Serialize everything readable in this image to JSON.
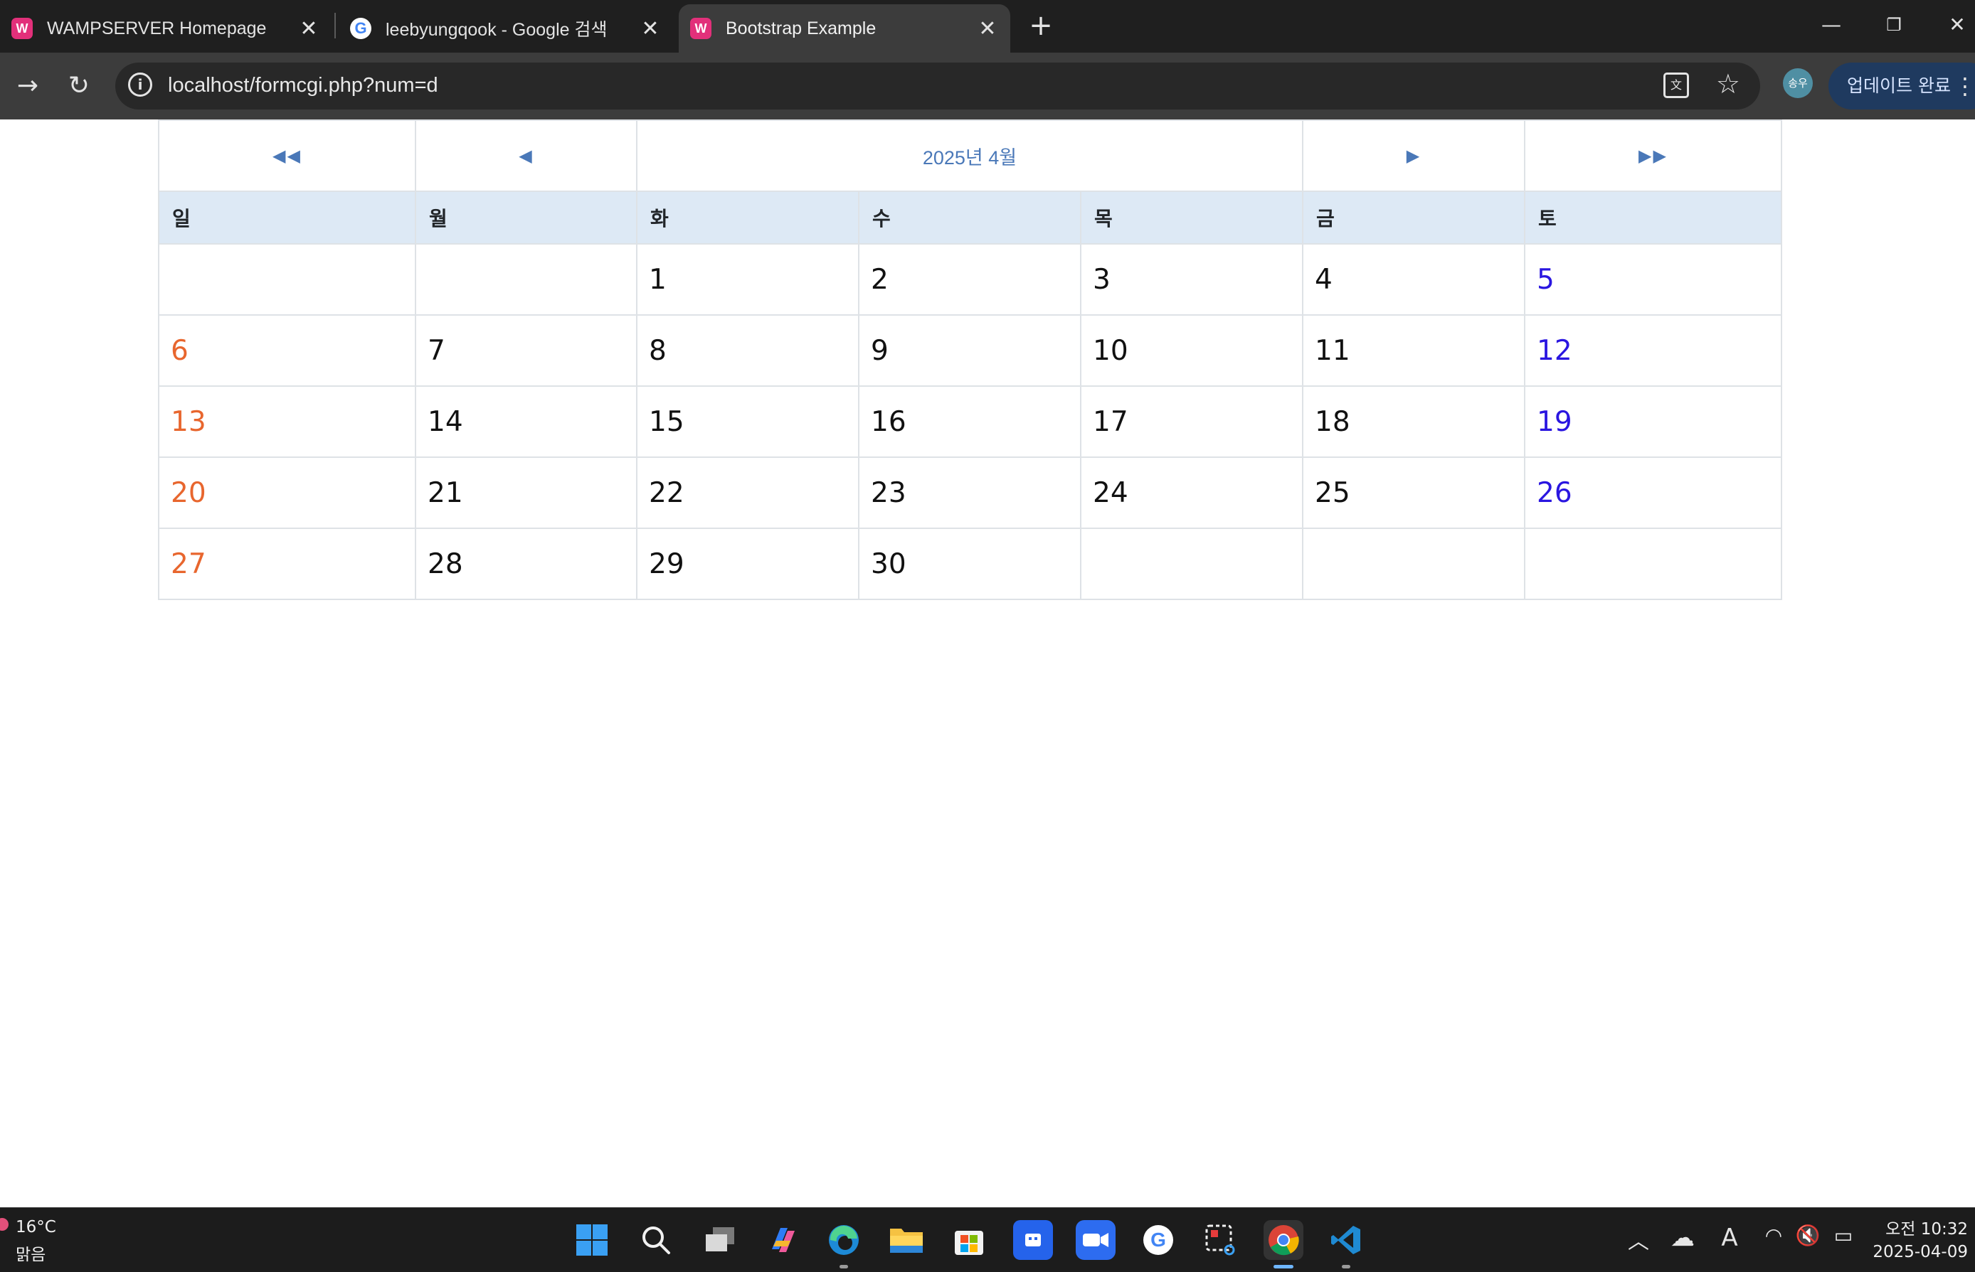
{
  "browser": {
    "tabs": [
      {
        "title": "WAMPSERVER Homepage",
        "favicon": "wamp-icon",
        "active": false
      },
      {
        "title": "leebyungqook - Google 검색",
        "favicon": "google-icon",
        "active": false
      },
      {
        "title": "Bootstrap Example",
        "favicon": "wamp-icon",
        "active": true
      }
    ],
    "address_bar": {
      "url": "localhost/formcgi.php?num=d"
    },
    "profile_initials": "송우",
    "update_label": "업데이트 완료"
  },
  "calendar": {
    "nav": {
      "prev_year": "◀◀",
      "prev_month": "◀",
      "title": "2025년 4월",
      "next_month": "▶",
      "next_year": "▶▶"
    },
    "weekdays": [
      "일",
      "월",
      "화",
      "수",
      "목",
      "금",
      "토"
    ],
    "weeks": [
      [
        "",
        "",
        "1",
        "2",
        "3",
        "4",
        "5"
      ],
      [
        "6",
        "7",
        "8",
        "9",
        "10",
        "11",
        "12"
      ],
      [
        "13",
        "14",
        "15",
        "16",
        "17",
        "18",
        "19"
      ],
      [
        "20",
        "21",
        "22",
        "23",
        "24",
        "25",
        "26"
      ],
      [
        "27",
        "28",
        "29",
        "30",
        "",
        "",
        ""
      ]
    ],
    "colors": {
      "sunday": "#e8662e",
      "saturday": "#2a16e0",
      "weekday": "#111111",
      "header_bg": "#dde9f5",
      "nav": "#4a78b8"
    }
  },
  "taskbar": {
    "weather": {
      "temp": "16°C",
      "condition": "맑음"
    },
    "apps": [
      "windows-start",
      "search",
      "task-view",
      "copilot",
      "edge",
      "file-explorer",
      "microsoft-store",
      "app-blue",
      "zoom",
      "google",
      "snipping-tool",
      "chrome",
      "vscode"
    ],
    "clock": {
      "time": "오전 10:32",
      "date": "2025-04-09"
    }
  }
}
